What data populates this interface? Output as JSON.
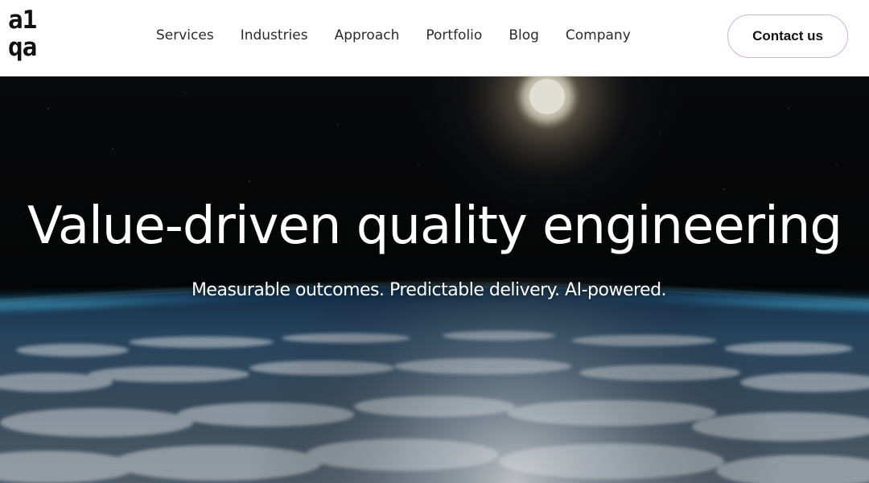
{
  "header": {
    "logo": {
      "line1": "a1",
      "line2": "qa"
    },
    "nav": [
      {
        "label": "Services"
      },
      {
        "label": "Industries"
      },
      {
        "label": "Approach"
      },
      {
        "label": "Portfolio"
      },
      {
        "label": "Blog"
      },
      {
        "label": "Company"
      }
    ],
    "contact_label": "Contact us"
  },
  "hero": {
    "title": "Value-driven quality engineering",
    "subtitle": "Measurable outcomes. Predictable delivery. AI-powered.",
    "background": "earth-from-space-image"
  },
  "colors": {
    "header_bg": "#ffffff",
    "contact_border": "#cdb1d9",
    "hero_text": "#ffffff",
    "space": "#050608"
  }
}
